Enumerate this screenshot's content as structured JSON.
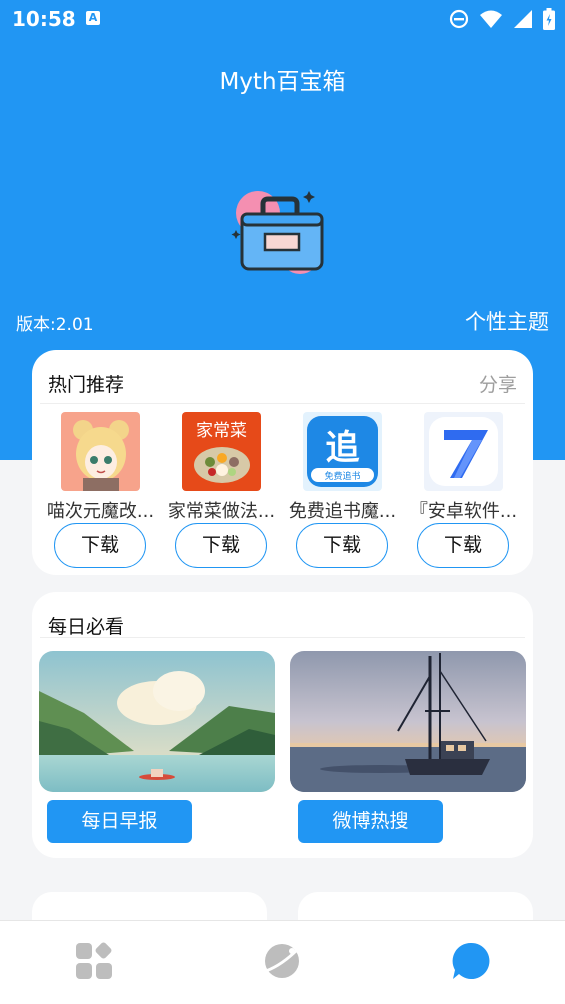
{
  "status": {
    "time": "10:58",
    "notification_icon": "A"
  },
  "header": {
    "title": "Myth百宝箱",
    "version": "版本:2.01",
    "theme_button": "个性主题"
  },
  "hot": {
    "title": "热门推荐",
    "share": "分享",
    "apps": [
      {
        "name": "喵次元魔改...",
        "download": "下载"
      },
      {
        "name": "家常菜做法...",
        "download": "下载"
      },
      {
        "name": "免费追书魔...",
        "download": "下载"
      },
      {
        "name": "『安卓软件...",
        "download": "下载"
      }
    ],
    "icon_text": {
      "jiachang": "家常菜",
      "zhui": "追",
      "zhui_sub": "免费追书"
    }
  },
  "daily": {
    "title": "每日必看",
    "morning_report": "每日早报",
    "weibo_hot": "微博热搜"
  },
  "nav": {
    "items": [
      "apps-grid-icon",
      "planet-icon",
      "chat-bubble-icon"
    ]
  },
  "colors": {
    "primary": "#2196f3",
    "background": "#f4f5f7"
  }
}
